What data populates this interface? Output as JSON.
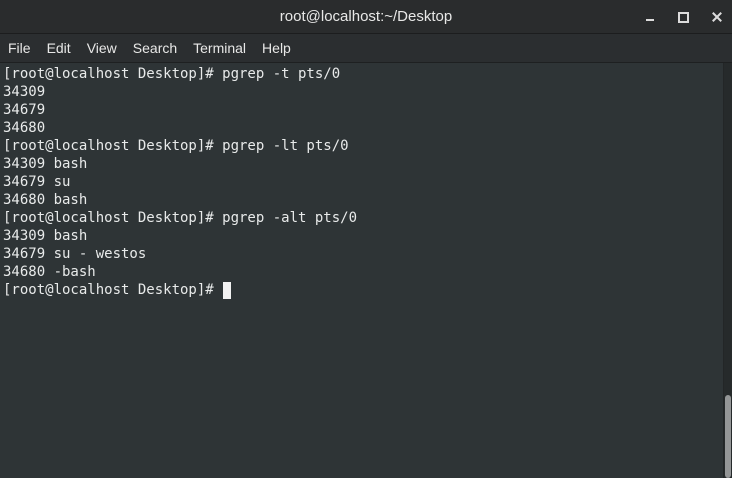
{
  "window": {
    "title": "root@localhost:~/Desktop"
  },
  "menu": {
    "items": [
      "File",
      "Edit",
      "View",
      "Search",
      "Terminal",
      "Help"
    ]
  },
  "terminal": {
    "lines": [
      "[root@localhost Desktop]# pgrep -t pts/0",
      "34309",
      "34679",
      "34680",
      "[root@localhost Desktop]# pgrep -lt pts/0",
      "34309 bash",
      "34679 su",
      "34680 bash",
      "[root@localhost Desktop]# pgrep -alt pts/0",
      "34309 bash",
      "34679 su - westos",
      "34680 -bash"
    ],
    "current_prompt": "[root@localhost Desktop]# "
  },
  "scrollbar": {
    "position_fraction": 0.8
  },
  "colors": {
    "terminal_background": "#2e3436",
    "terminal_foreground": "#e8eaea",
    "titlebar_background": "#2a2c2d"
  }
}
